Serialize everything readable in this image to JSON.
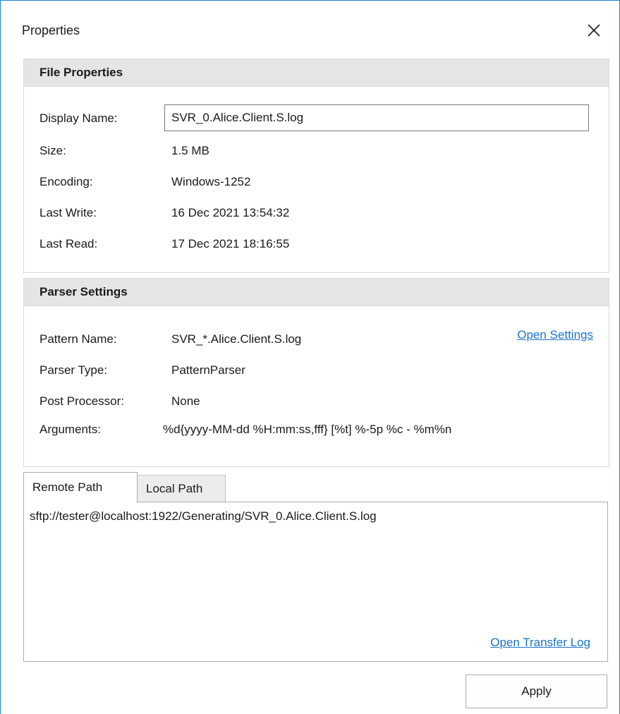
{
  "window": {
    "title": "Properties"
  },
  "file_properties": {
    "header": "File Properties",
    "display_name_label": "Display Name:",
    "display_name_value": "SVR_0.Alice.Client.S.log",
    "size_label": "Size:",
    "size_value": "1.5 MB",
    "encoding_label": "Encoding:",
    "encoding_value": "Windows-1252",
    "last_write_label": "Last Write:",
    "last_write_value": "16 Dec 2021 13:54:32",
    "last_read_label": "Last Read:",
    "last_read_value": "17 Dec 2021 18:16:55"
  },
  "parser_settings": {
    "header": "Parser Settings",
    "pattern_name_label": "Pattern Name:",
    "pattern_name_value": "SVR_*.Alice.Client.S.log",
    "open_settings_link": "Open Settings",
    "parser_type_label": "Parser Type:",
    "parser_type_value": "PatternParser",
    "post_processor_label": "Post Processor:",
    "post_processor_value": "None",
    "arguments_label": "Arguments:",
    "arguments_value": "%d{yyyy-MM-dd %H:mm:ss,fff} [%t] %-5p %c - %m%n"
  },
  "path_tabs": {
    "tabs": [
      {
        "label": "Remote Path",
        "active": true
      },
      {
        "label": "Local Path",
        "active": false
      }
    ],
    "remote_path": "sftp://tester@localhost:1922/Generating/SVR_0.Alice.Client.S.log",
    "transfer_log_link": "Open Transfer Log"
  },
  "footer": {
    "apply_label": "Apply"
  },
  "colors": {
    "accent_border": "#1883d7",
    "link": "#1a73c7",
    "group_header_bg": "#e5e5e5"
  },
  "icons": {
    "close": "close-icon"
  }
}
